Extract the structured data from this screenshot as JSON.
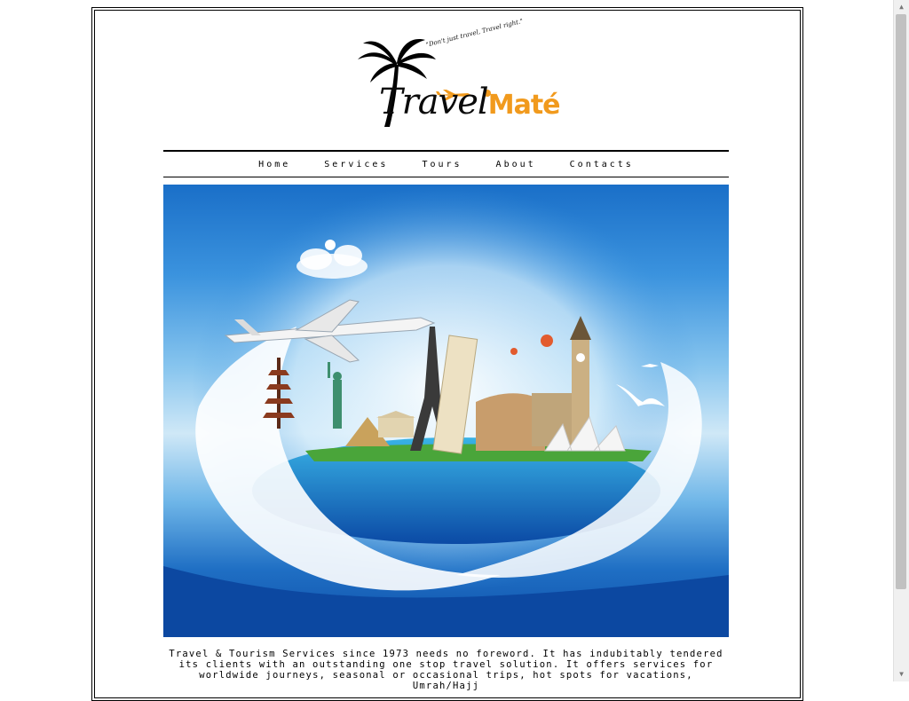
{
  "logo": {
    "tagline": "\"Don't just travel, Travel right.\"",
    "word_main": "Travel",
    "word_accent": "Maté"
  },
  "nav": {
    "items": [
      {
        "label": "Home"
      },
      {
        "label": "Services"
      },
      {
        "label": "Tours"
      },
      {
        "label": "About"
      },
      {
        "label": "Contacts"
      }
    ]
  },
  "intro": {
    "text": "Travel & Tourism Services since 1973 needs no foreword. It has indubitably tendered its clients with an outstanding one stop travel solution. It offers services for worldwide journeys, seasonal or occasional trips, hot spots for vacations, Umrah/Hajj"
  },
  "colors": {
    "accent": "#f19a1d",
    "sky": "#3b93de",
    "ocean": "#0e4ea8"
  }
}
